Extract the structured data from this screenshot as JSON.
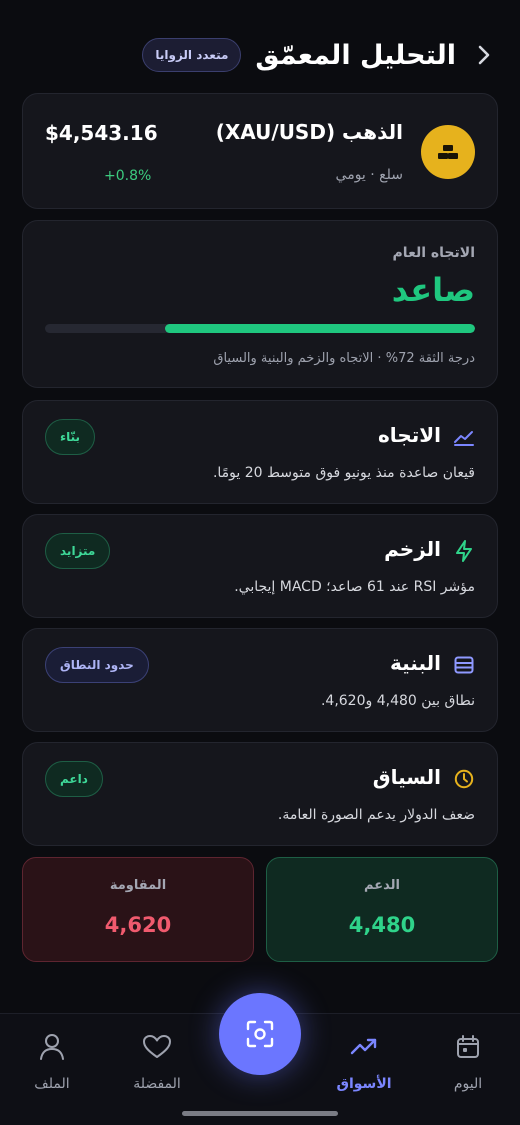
{
  "header": {
    "title": "التحليل المعمّق",
    "mode_chip": "متعدد الزوايا"
  },
  "asset": {
    "name": "الذهب (XAU/USD)",
    "meta": "سلع · يومي",
    "price": "$4,543.16",
    "change": "+0.8%",
    "coin_color": "#e6b21d"
  },
  "trend": {
    "label": "الاتجاه العام",
    "value": "صاعد",
    "confidence_percent": 72,
    "note": "درجة الثقة 72% · الاتجاه والزخم والبنية والسياق"
  },
  "metrics": [
    {
      "title": "الاتجاه",
      "desc": "قيعان صاعدة منذ يونيو فوق متوسط 20 يومًا.",
      "badge": "بنّاء",
      "icon": "trend-line-icon"
    },
    {
      "title": "الزخم",
      "desc": "مؤشر RSI عند 61 صاعد؛ MACD إيجابي.",
      "badge": "متزايد",
      "icon": "lightning-icon"
    },
    {
      "title": "البنية",
      "desc": "نطاق بين 4,480 و4,620.",
      "badge": "حدود النطاق",
      "icon": "layers-icon"
    },
    {
      "title": "السياق",
      "desc": "ضعف الدولار يدعم الصورة العامة.",
      "badge": "داعم",
      "icon": "clock-icon"
    }
  ],
  "levels": {
    "support_label": "الدعم",
    "support_value": "4,480",
    "resistance_label": "المقاومة",
    "resistance_value": "4,620"
  },
  "nav": {
    "today": "اليوم",
    "markets": "الأسواق",
    "favorites": "المفضلة",
    "profile": "الملف",
    "active": "markets",
    "accent": "#7b86ff"
  }
}
